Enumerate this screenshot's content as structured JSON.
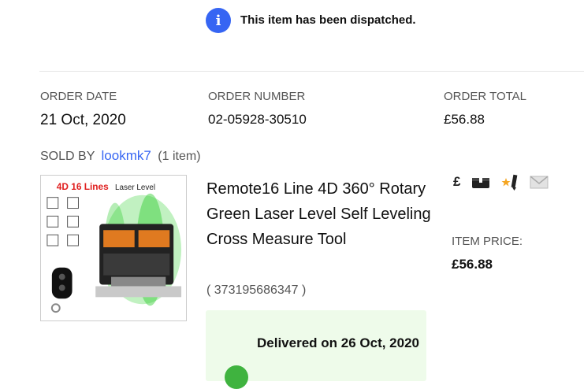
{
  "banner": {
    "icon_glyph": "i",
    "message": "This item has been dispatched."
  },
  "order": {
    "date_label": "ORDER DATE",
    "date_value": "21 Oct, 2020",
    "number_label": "ORDER NUMBER",
    "number_value": "02-05928-30510",
    "total_label": "ORDER TOTAL",
    "total_value": "£56.88"
  },
  "seller": {
    "prefix": "SOLD BY",
    "name": "lookmk7",
    "count": "(1 item)"
  },
  "item": {
    "image_label_red": "4D 16 Lines",
    "image_label_black": "Laser Level",
    "title": "Remote16 Line 4D 360° Rotary Green Laser Level Self Leveling Cross Measure Tool",
    "id": "( 373195686347 )",
    "delivery": "Delivered on 26 Oct, 2020",
    "price_label": "ITEM PRICE:",
    "price_value": "£56.88"
  },
  "icons": {
    "pound_glyph": "£",
    "names": [
      "pound-icon",
      "shipping-box-icon",
      "feedback-icon",
      "message-icon"
    ]
  },
  "colors": {
    "accent": "#3665f3",
    "delivery_bg": "#eefbea",
    "delivery_dot": "#3fb33f",
    "image_label_red": "#e02020"
  }
}
